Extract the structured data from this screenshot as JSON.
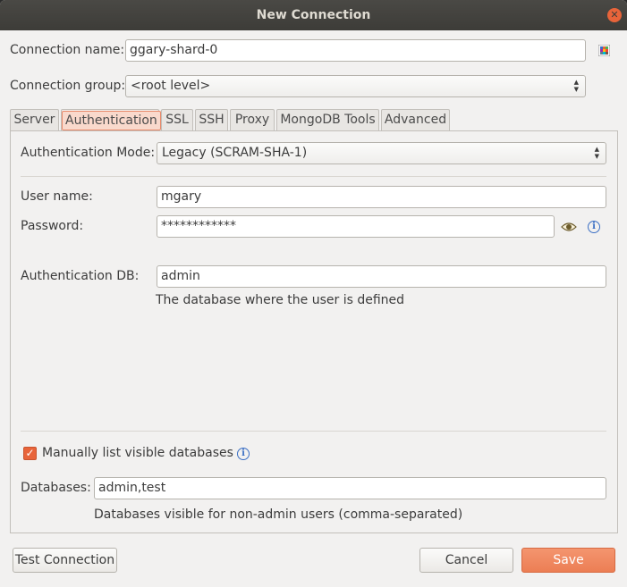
{
  "window": {
    "title": "New Connection"
  },
  "connection": {
    "name_label": "Connection name:",
    "name_value": "ggary-shard-0",
    "group_label": "Connection group:",
    "group_value": "<root level>"
  },
  "tabs": [
    {
      "label": "Server"
    },
    {
      "label": "Authentication"
    },
    {
      "label": "SSL"
    },
    {
      "label": "SSH"
    },
    {
      "label": "Proxy"
    },
    {
      "label": "MongoDB Tools"
    },
    {
      "label": "Advanced"
    }
  ],
  "active_tab": "Authentication",
  "auth": {
    "mode_label": "Authentication Mode:",
    "mode_value": "Legacy (SCRAM-SHA-1)",
    "username_label": "User name:",
    "username_value": "mgary",
    "password_label": "Password:",
    "password_value": "************",
    "db_label": "Authentication DB:",
    "db_value": "admin",
    "db_hint": "The database where the user is defined",
    "manual_list_label": "Manually list visible databases",
    "manual_list_checked": true,
    "databases_label": "Databases:",
    "databases_value": "admin,test",
    "databases_hint": "Databases visible for non-admin users (comma-separated)"
  },
  "buttons": {
    "test": "Test Connection",
    "cancel": "Cancel",
    "save": "Save"
  },
  "icons": {
    "close": "close-icon",
    "color_picker": "color-grid-icon",
    "show_password": "eye-icon",
    "info": "info-icon"
  },
  "colors": {
    "accent": "#e8643a",
    "titlebar": "#3d3c38",
    "info": "#3b6fc4"
  }
}
